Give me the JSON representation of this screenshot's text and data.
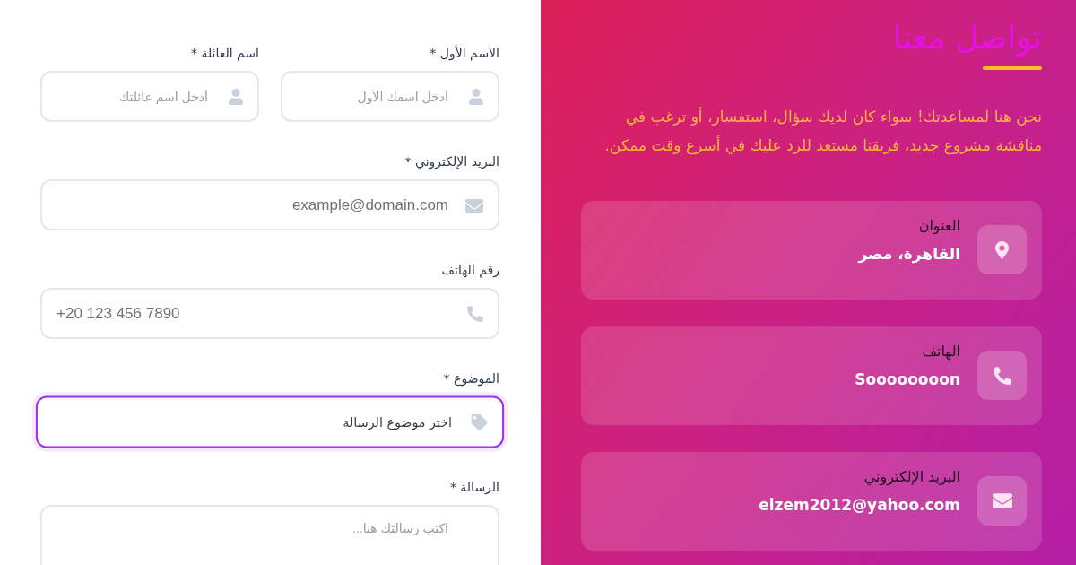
{
  "contact_info": {
    "title": "تواصل معنا",
    "description": "نحن هنا لمساعدتك! سواء كان لديك سؤال، استفسار، أو ترغب في مناقشة مشروع جديد، فريقنا مستعد للرد عليك في أسرع وقت ممكن.",
    "items": [
      {
        "kind": "address",
        "label": "العنوان",
        "value": "القاهرة، مصر"
      },
      {
        "kind": "phone",
        "label": "الهاتف",
        "value": "Soooooooon"
      },
      {
        "kind": "email",
        "label": "البريد الإلكتروني",
        "value": "elzem2012@yahoo.com"
      }
    ]
  },
  "form": {
    "rows": [
      {
        "fields": [
          {
            "kind": "text",
            "label": "الاسم الأول *",
            "placeholder": "أدخل اسمك الأول",
            "focused": false
          },
          {
            "kind": "text",
            "label": "اسم العائلة *",
            "placeholder": "أدخل اسم عائلتك",
            "focused": false
          }
        ]
      },
      {
        "fields": [
          {
            "kind": "email",
            "label": "البريد الإلكتروني *",
            "placeholder": "example@domain.com",
            "focused": false
          }
        ]
      },
      {
        "fields": [
          {
            "kind": "tel",
            "label": "رقم الهاتف",
            "placeholder": "+20 123 456 7890",
            "focused": false
          }
        ]
      },
      {
        "fields": [
          {
            "kind": "select",
            "label": "الموضوع *",
            "value": "اختر موضوع الرسالة",
            "focused": true
          }
        ]
      },
      {
        "fields": [
          {
            "kind": "textarea",
            "label": "الرسالة *",
            "placeholder": "اكتب رسالتك هنا...",
            "focused": false
          }
        ]
      }
    ]
  }
}
